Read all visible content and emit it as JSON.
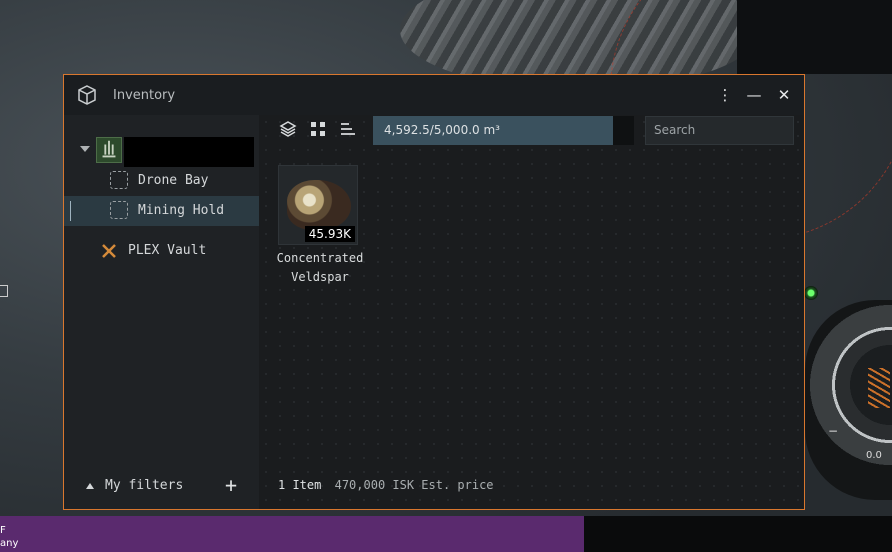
{
  "window": {
    "title": "Inventory",
    "buttons": {
      "menu": "⋮",
      "minimize": "—",
      "close": "✕"
    }
  },
  "sidebar": {
    "ship": {
      "name_redacted": true
    },
    "children": [
      {
        "label": "Drone Bay",
        "icon": "drone-bay-icon"
      },
      {
        "label": "Mining Hold",
        "icon": "mining-hold-icon",
        "selected": true
      }
    ],
    "plex": {
      "label": "PLEX Vault",
      "icon": "plex-icon"
    },
    "filters_label": "My filters",
    "add_label": "+"
  },
  "toolbar": {
    "capacity_text": "4,592.5/5,000.0 m³",
    "capacity_fraction": 0.9185,
    "search_placeholder": "Search"
  },
  "items": [
    {
      "name_line1": "Concentrated",
      "name_line2": "Veldspar",
      "quantity": "45.93K"
    }
  ],
  "status": {
    "count": "1 Item",
    "price": "470,000 ISK Est. price"
  },
  "background": {
    "hud_value": "0.0",
    "hud_minus": "−",
    "strip_line1": "F",
    "strip_line2": "any"
  },
  "colors": {
    "accent_border": "#d9772e",
    "selected_row": "#2b3a42",
    "capacity_fill": "#3a515e"
  }
}
